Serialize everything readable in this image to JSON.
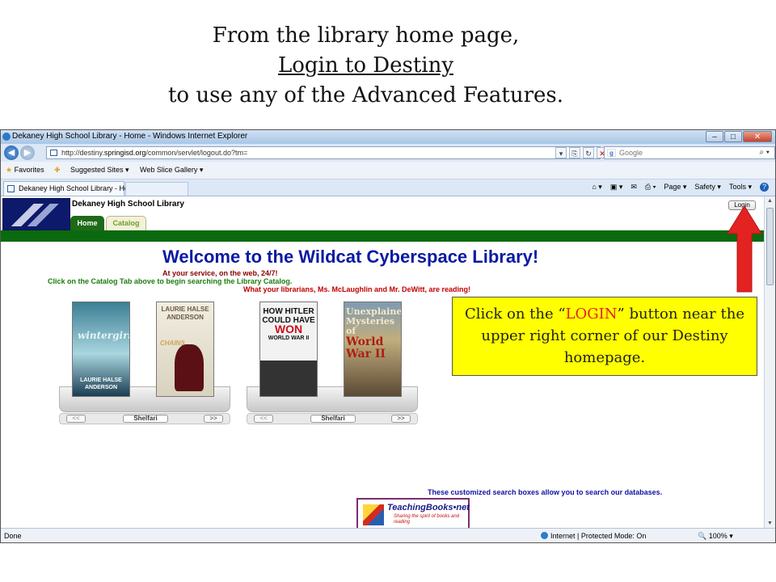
{
  "slide": {
    "heading_line1": "From the library home page,",
    "heading_line2": "Login to Destiny",
    "heading_line3": "to use any of the Advanced Features."
  },
  "browser": {
    "window_title": "Dekaney High School Library - Home - Windows Internet Explorer",
    "window_buttons": [
      "–",
      "□",
      "✕"
    ],
    "url_prefix": "http://destiny.",
    "url_domain": "springisd.org",
    "url_rest": "/common/servlet/logout.do?tm=",
    "search_placeholder": "Google",
    "favorites_label": "Favorites",
    "suggested_sites": "Suggested Sites ▾",
    "web_slice_gallery": "Web Slice Gallery ▾",
    "tab_title": "Dekaney High School Library - Home",
    "commands": [
      "Page ▾",
      "Safety ▾",
      "Tools ▾"
    ],
    "status_text": "Done",
    "zone_text": "Internet | Protected Mode: On",
    "zoom_text": "100%"
  },
  "library": {
    "name": "Dekaney High School Library",
    "tabs": [
      "Home",
      "Catalog"
    ],
    "login_label": "Login",
    "welcome": "Welcome to the Wildcat Cyberspace Library!",
    "service_line": "At your service, on the web, 24/7!",
    "catalog_hint": "Click on the Catalog Tab above to begin searching the Library Catalog.",
    "reading_line": "What your librarians, Ms. McLaughlin and Mr. DeWitt, are reading!",
    "shelf_prev": "<<",
    "shelf_next": ">>",
    "shelf_brand": "Shelfari",
    "books": [
      {
        "title": "wintergirls",
        "author": "LAURIE HALSE ANDERSON"
      },
      {
        "title": "CHAINS",
        "author": "LAURIE HALSE ANDERSON"
      },
      {
        "title": "HOW HITLER COULD HAVE",
        "title_accent": "WON",
        "subtitle": "WORLD WAR II"
      },
      {
        "title": "Unexplained Mysteries of",
        "title_accent": "World War II"
      }
    ],
    "search_info": "These customized search boxes allow you to search our databases.",
    "teachingbooks_name": "TeachingBooks•net",
    "teachingbooks_tagline": "Sharing the spirit of books and reading"
  },
  "callout": {
    "pre": "Click on the “",
    "highlight": "LOGIN",
    "post": "” button near the upper right corner of our Destiny homepage."
  },
  "colors": {
    "destiny_green": "#0b6a10",
    "welcome_blue": "#0a1aa3",
    "callout_yellow": "#ffff00",
    "arrow_red": "#e32222"
  }
}
